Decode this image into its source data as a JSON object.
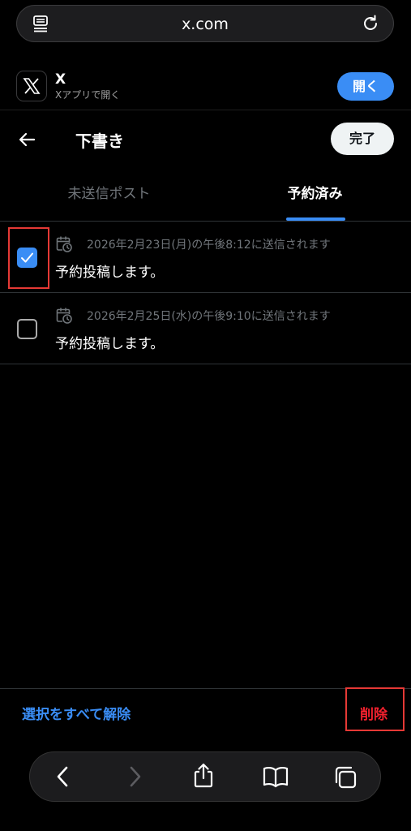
{
  "browser": {
    "url": "x.com"
  },
  "app_banner": {
    "name": "X",
    "subtitle": "Xアプリで開く",
    "open_label": "開く"
  },
  "header": {
    "title": "下書き",
    "done_label": "完了"
  },
  "tabs": [
    {
      "label": "未送信ポスト",
      "active": false
    },
    {
      "label": "予約済み",
      "active": true
    }
  ],
  "posts": [
    {
      "checked": true,
      "schedule": "2026年2月23日(月)の午後8:12に送信されます",
      "text": "予約投稿します。"
    },
    {
      "checked": false,
      "schedule": "2026年2月25日(水)の午後9:10に送信されます",
      "text": "予約投稿します。"
    }
  ],
  "actions": {
    "deselect_all_label": "選択をすべて解除",
    "delete_label": "削除"
  },
  "colors": {
    "accent": "#3a8df5",
    "danger": "#f4212e",
    "annotation": "#e53935",
    "background": "#000000"
  },
  "icons": {
    "reader": "reader-icon",
    "reload": "reload-icon",
    "back": "arrow-left-icon",
    "calendar": "calendar-clock-icon",
    "share": "share-icon",
    "bookmarks": "book-icon",
    "tabs": "tabs-icon"
  }
}
